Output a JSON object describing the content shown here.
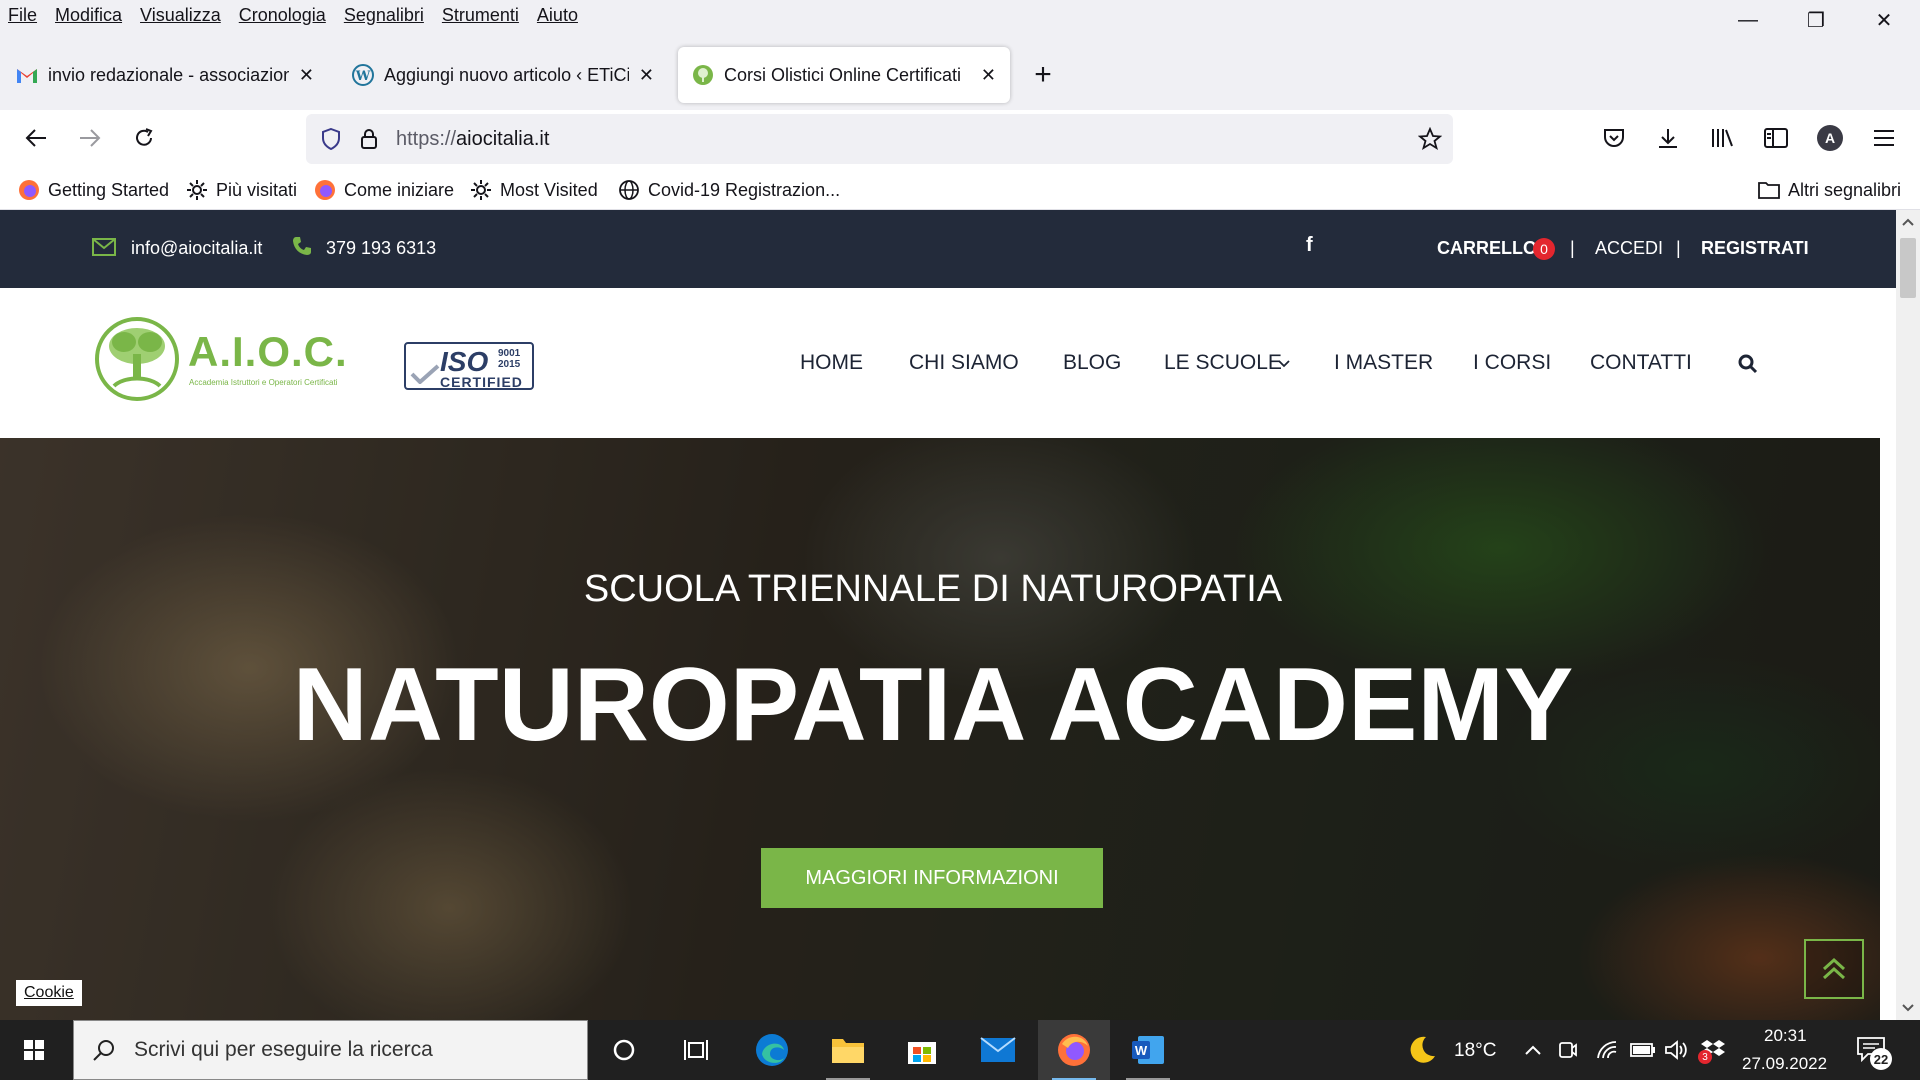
{
  "menu": [
    "File",
    "Modifica",
    "Visualizza",
    "Cronologia",
    "Segnalibri",
    "Strumenti",
    "Aiuto"
  ],
  "window_controls": {
    "minimize": "—",
    "restore": "❐",
    "close": "✕"
  },
  "tabs": [
    {
      "label": "invio redazionale - associazione",
      "icon": "gmail-icon",
      "active": false
    },
    {
      "label": "Aggiungi nuovo articolo ‹ ETiCi",
      "icon": "wordpress-icon",
      "active": false
    },
    {
      "label": "Corsi Olistici Online Certificati",
      "icon": "aioc-favicon-icon",
      "active": true
    }
  ],
  "tab_close": "✕",
  "new_tab": "+",
  "url": {
    "prefix": "https://",
    "domain": "aiocitalia.it"
  },
  "bookmarks": [
    {
      "label": "Getting Started",
      "icon": "firefox-icon"
    },
    {
      "label": "Più visitati",
      "icon": "gear-icon"
    },
    {
      "label": "Come iniziare",
      "icon": "firefox-icon"
    },
    {
      "label": "Most Visited",
      "icon": "gear-icon"
    },
    {
      "label": "Covid-19 Registrazion...",
      "icon": "globe-icon"
    }
  ],
  "other_bookmarks": "Altri segnalibri",
  "profile_initial": "A",
  "site": {
    "email": "info@aiocitalia.it",
    "phone": "379 193 6313",
    "facebook": "f",
    "cart_label": "CARRELLO",
    "cart_count": "0",
    "login": "ACCEDI",
    "register": "REGISTRATI",
    "separator": "|",
    "logo_text": "A.I.O.C.",
    "logo_tagline": "Accademia Istruttori e Operatori Certificati",
    "iso_text": "ISO",
    "iso_codes": [
      "9001",
      "2015"
    ],
    "iso_certified": "CERTIFIED",
    "nav": [
      "HOME",
      "CHI SIAMO",
      "BLOG",
      "LE SCUOLE",
      "I MASTER",
      "I CORSI",
      "CONTATTI"
    ],
    "hero_subtitle": "SCUOLA TRIENNALE DI NATUROPATIA",
    "hero_title": "NATUROPATIA ACADEMY",
    "hero_button": "MAGGIORI INFORMAZIONI",
    "cookie": "Cookie"
  },
  "taskbar": {
    "search_placeholder": "Scrivi qui per eseguire la ricerca",
    "weather": "18°C",
    "time": "20:31",
    "date": "27.09.2022",
    "notifications": "22",
    "badge": "3"
  },
  "colors": {
    "accent_green": "#7ab648",
    "dark_navy": "#232b3b",
    "cart_badge": "#e3262e"
  }
}
